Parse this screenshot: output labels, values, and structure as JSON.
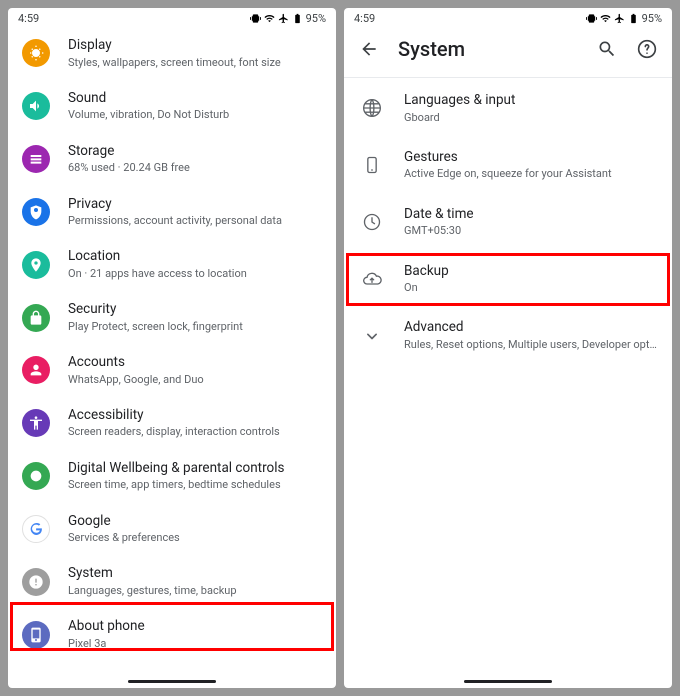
{
  "statusbar": {
    "time": "4:59",
    "battery": "95%"
  },
  "left": {
    "items": [
      {
        "label": "Display",
        "sub": "Styles, wallpapers, screen timeout, font size"
      },
      {
        "label": "Sound",
        "sub": "Volume, vibration, Do Not Disturb"
      },
      {
        "label": "Storage",
        "sub": "68% used · 20.24 GB free"
      },
      {
        "label": "Privacy",
        "sub": "Permissions, account activity, personal data"
      },
      {
        "label": "Location",
        "sub": "On · 21 apps have access to location"
      },
      {
        "label": "Security",
        "sub": "Play Protect, screen lock, fingerprint"
      },
      {
        "label": "Accounts",
        "sub": "WhatsApp, Google, and Duo"
      },
      {
        "label": "Accessibility",
        "sub": "Screen readers, display, interaction controls"
      },
      {
        "label": "Digital Wellbeing & parental controls",
        "sub": "Screen time, app timers, bedtime schedules"
      },
      {
        "label": "Google",
        "sub": "Services & preferences"
      },
      {
        "label": "System",
        "sub": "Languages, gestures, time, backup"
      },
      {
        "label": "About phone",
        "sub": "Pixel 3a"
      }
    ]
  },
  "right": {
    "title": "System",
    "items": [
      {
        "label": "Languages & input",
        "sub": "Gboard"
      },
      {
        "label": "Gestures",
        "sub": "Active Edge on, squeeze for your Assistant"
      },
      {
        "label": "Date & time",
        "sub": "GMT+05:30"
      },
      {
        "label": "Backup",
        "sub": "On"
      },
      {
        "label": "Advanced",
        "sub": "Rules, Reset options, Multiple users, Developer options,…"
      }
    ]
  }
}
